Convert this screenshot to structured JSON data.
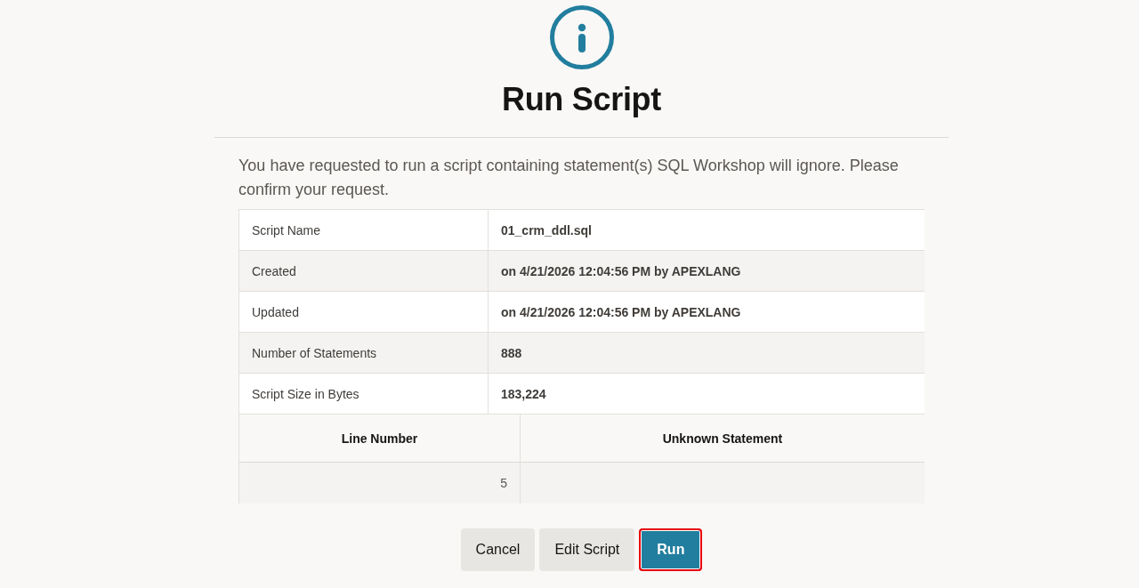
{
  "title": "Run Script",
  "message": "You have requested to run a script containing statement(s) SQL Workshop will ignore. Please confirm your request.",
  "script_details": [
    {
      "label": "Script Name",
      "value": "01_crm_ddl.sql"
    },
    {
      "label": "Created",
      "value": "on 4/21/2026 12:04:56 PM by APEXLANG"
    },
    {
      "label": "Updated",
      "value": "on 4/21/2026 12:04:56 PM by APEXLANG"
    },
    {
      "label": "Number of Statements",
      "value": "888"
    },
    {
      "label": "Script Size in Bytes",
      "value": "183,224"
    }
  ],
  "unknown_statements": {
    "columns": [
      "Line Number",
      "Unknown Statement"
    ],
    "rows": [
      {
        "line_number": "5"
      }
    ]
  },
  "buttons": [
    {
      "label": "Cancel",
      "kind": "secondary",
      "focused": false
    },
    {
      "label": "Edit Script",
      "kind": "secondary",
      "focused": false
    },
    {
      "label": "Run",
      "kind": "primary",
      "focused": true
    }
  ]
}
